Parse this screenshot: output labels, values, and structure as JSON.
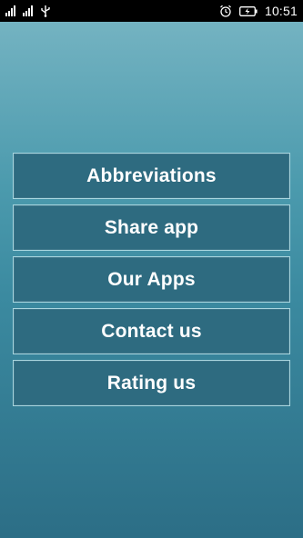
{
  "status_bar": {
    "time": "10:51",
    "icons": [
      "signal-icon",
      "signal-icon",
      "usb-icon",
      "alarm-icon",
      "battery-charging-icon"
    ]
  },
  "menu": {
    "items": [
      {
        "label": "Abbreviations"
      },
      {
        "label": "Share app"
      },
      {
        "label": "Our Apps"
      },
      {
        "label": "Contact us"
      },
      {
        "label": "Rating us"
      }
    ]
  },
  "colors": {
    "button_fill": "#2e6b80",
    "button_border": "#a9d6df",
    "background_top": "#79b6c4",
    "background_bottom": "#2c6e86"
  }
}
